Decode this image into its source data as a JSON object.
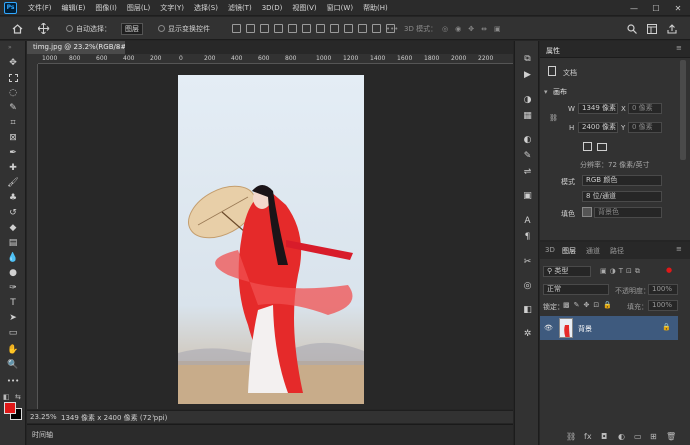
{
  "menubar": {
    "logo": "Ps",
    "items": [
      "文件(F)",
      "编辑(E)",
      "图像(I)",
      "图层(L)",
      "文字(Y)",
      "选择(S)",
      "滤镜(T)",
      "3D(D)",
      "视图(V)",
      "窗口(W)",
      "帮助(H)"
    ],
    "minimize": "—",
    "maximize": "☐",
    "close": "✕"
  },
  "options": {
    "auto_select_label": "自动选择：",
    "auto_select_value": "图层",
    "show_transform_label": "显示变换控件",
    "mode_3d_label": "3D 模式："
  },
  "document": {
    "tab_title": "timg.jpg @ 23.2%(RGB/8#)",
    "tab_close": "×",
    "zoom": "23.25%",
    "dimensions": "1349 像素 x 2400 像素 (72 ppi)",
    "timeline_label": "时间轴"
  },
  "ruler": {
    "top_labels": [
      "1000",
      "800",
      "600",
      "400",
      "200",
      "0",
      "200",
      "400",
      "600",
      "800",
      "1000",
      "1200",
      "1400",
      "1600",
      "1800",
      "2000",
      "2200"
    ]
  },
  "properties": {
    "tab_label": "属性",
    "doc_label": "文档",
    "section": "画布",
    "w_label": "W",
    "w_value": "1349 像素",
    "h_label": "H",
    "h_value": "2400 像素",
    "x_label": "X",
    "x_value": "0 像素",
    "y_label": "Y",
    "y_value": "0 像素",
    "resolution": "分辨率：72 像素/英寸",
    "mode_label": "模式",
    "mode_value": "RGB 颜色",
    "depth_value": "8 位/通道",
    "fill_label": "填色",
    "fill_value": "背景色"
  },
  "layers": {
    "tabs": [
      "3D",
      "图层",
      "通道",
      "路径"
    ],
    "active_tab": "图层",
    "kind_filter": "类型",
    "blend_mode": "正常",
    "opacity_label": "不透明度：",
    "opacity_value": "100%",
    "lock_label": "锁定：",
    "fill_label": "填充：",
    "fill_value": "100%",
    "layer_name": "背景"
  },
  "colors": {
    "foreground": "#e01818",
    "background": "#000000",
    "accent": "#3e5a7e"
  }
}
